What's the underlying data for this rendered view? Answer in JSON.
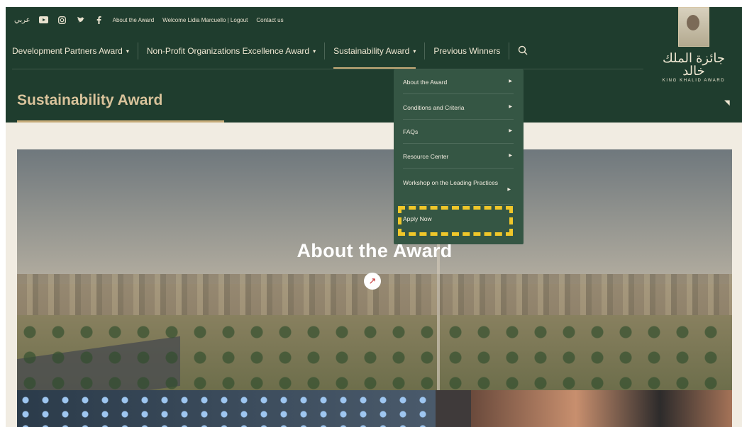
{
  "topbar": {
    "lang": "عربي",
    "icons": [
      "youtube-icon",
      "instagram-icon",
      "twitter-icon",
      "facebook-icon"
    ],
    "links": [
      "About the Award",
      "Welcome Lidia Marcuello | Logout",
      "Contact us"
    ]
  },
  "nav": {
    "items": [
      {
        "label": "Development Partners Award",
        "has_caret": true
      },
      {
        "label": "Non-Profit Organizations Excellence Award",
        "has_caret": true
      },
      {
        "label": "Sustainability Award",
        "has_caret": true,
        "active": true
      },
      {
        "label": "Previous Winners",
        "has_caret": false
      }
    ],
    "search_icon": "search-icon"
  },
  "logo": {
    "arabic_name": "جائزة الملك خالد",
    "english_name": "KING KHALID AWARD"
  },
  "page": {
    "title": "Sustainability Award"
  },
  "dropdown": {
    "items": [
      "About the Award",
      "Conditions and Criteria",
      "FAQs",
      "Resource Center",
      "Workshop on the Leading Practices",
      "Apply Now"
    ]
  },
  "hero": {
    "caption": "About the Award",
    "action_icon": "arrow-up-right-icon"
  },
  "colors": {
    "header_bg": "#1f3d2e",
    "dropdown_bg": "#355644",
    "accent": "#c6ab79",
    "highlight": "#f0c72a"
  }
}
